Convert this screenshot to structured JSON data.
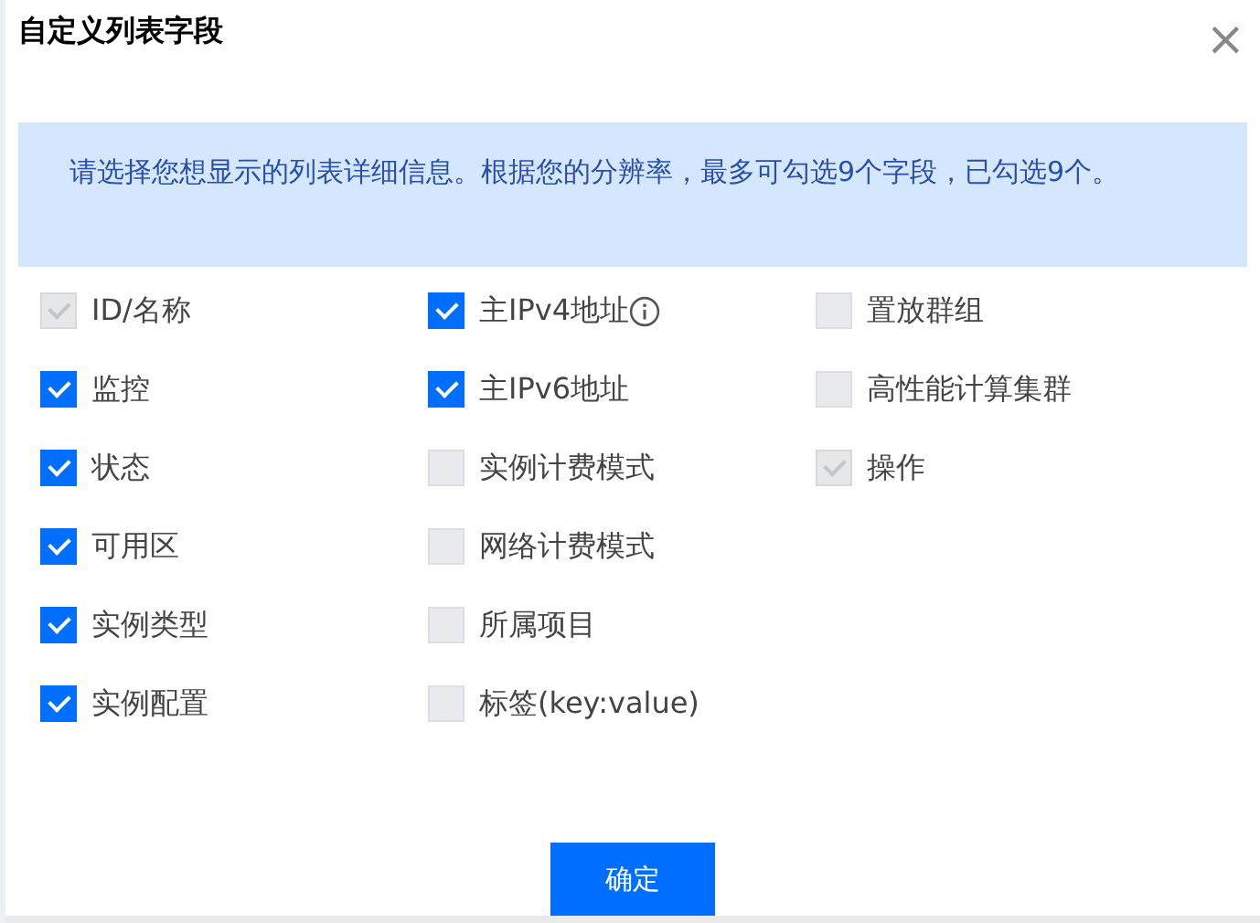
{
  "dialog": {
    "title": "自定义列表字段",
    "close": "×"
  },
  "notice": "请选择您想显示的列表详细信息。根据您的分辨率，最多可勾选9个字段，已勾选9个。",
  "field_columns": [
    {
      "fields": [
        {
          "label": "ID/名称",
          "checked": true,
          "disabled": true,
          "info": false
        },
        {
          "label": "监控",
          "checked": true,
          "disabled": false,
          "info": false
        },
        {
          "label": "状态",
          "checked": true,
          "disabled": false,
          "info": false
        },
        {
          "label": "可用区",
          "checked": true,
          "disabled": false,
          "info": false
        },
        {
          "label": "实例类型",
          "checked": true,
          "disabled": false,
          "info": false
        },
        {
          "label": "实例配置",
          "checked": true,
          "disabled": false,
          "info": false
        }
      ]
    },
    {
      "fields": [
        {
          "label": "主IPv4地址",
          "checked": true,
          "disabled": false,
          "info": true
        },
        {
          "label": "主IPv6地址",
          "checked": true,
          "disabled": false,
          "info": false
        },
        {
          "label": "实例计费模式",
          "checked": false,
          "disabled": true,
          "info": false
        },
        {
          "label": "网络计费模式",
          "checked": false,
          "disabled": true,
          "info": false
        },
        {
          "label": "所属项目",
          "checked": false,
          "disabled": true,
          "info": false
        },
        {
          "label": "标签(key:value)",
          "checked": false,
          "disabled": true,
          "info": false
        }
      ]
    },
    {
      "fields": [
        {
          "label": "置放群组",
          "checked": false,
          "disabled": true,
          "info": false
        },
        {
          "label": "高性能计算集群",
          "checked": false,
          "disabled": true,
          "info": false
        },
        {
          "label": "操作",
          "checked": true,
          "disabled": true,
          "info": false
        }
      ]
    }
  ],
  "buttons": [
    {
      "label": "确定",
      "kind": "primary"
    }
  ]
}
